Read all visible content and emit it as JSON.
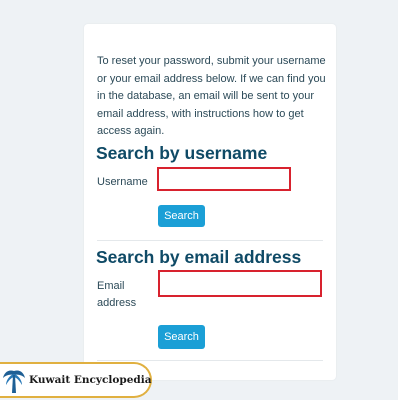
{
  "intro_text": "To reset your password, submit your username or your email address below. If we can find you in the database, an email will be sent to your email address, with instructions how to get access again.",
  "username_section": {
    "heading": "Search by username",
    "field_label": "Username",
    "field_value": "",
    "button_label": "Search"
  },
  "email_section": {
    "heading": "Search by email address",
    "field_label": "Email address",
    "field_value": "",
    "button_label": "Search"
  },
  "watermark": {
    "text": "Kuwait Encyclopedia"
  },
  "colors": {
    "heading": "#0f4a66",
    "button": "#1b9fd6",
    "input_border": "#d8222e",
    "badge_border": "#e0b040",
    "logo": "#1e5f95"
  }
}
